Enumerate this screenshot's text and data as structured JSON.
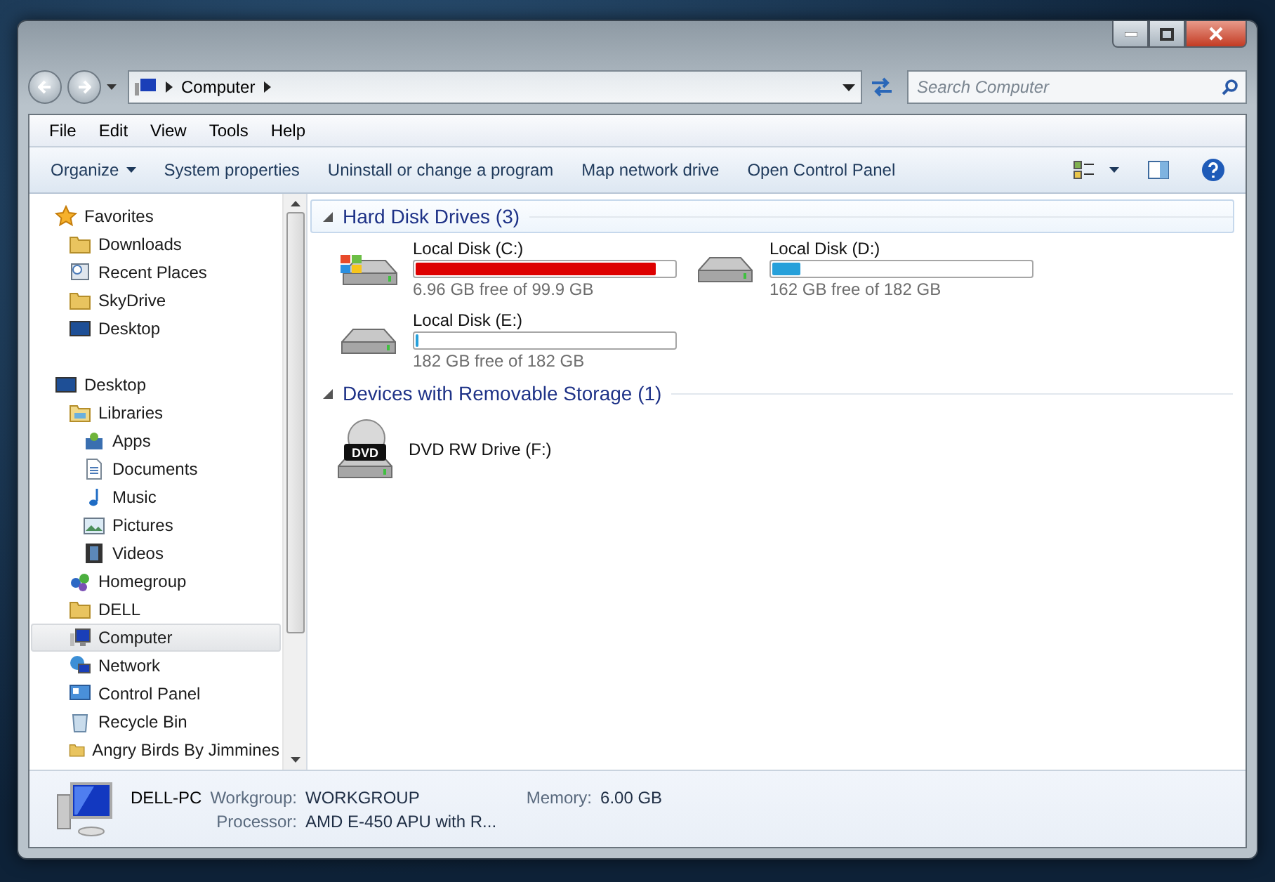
{
  "address_bar": {
    "crumbs": [
      "Computer"
    ]
  },
  "search": {
    "placeholder": "Search Computer"
  },
  "menu_bar": [
    "File",
    "Edit",
    "View",
    "Tools",
    "Help"
  ],
  "command_bar": [
    {
      "label": "Organize",
      "dropdown": true
    },
    {
      "label": "System properties",
      "dropdown": false
    },
    {
      "label": "Uninstall or change a program",
      "dropdown": false
    },
    {
      "label": "Map network drive",
      "dropdown": false
    },
    {
      "label": "Open Control Panel",
      "dropdown": false
    }
  ],
  "navigation": [
    {
      "label": "Favorites",
      "kind": "star",
      "selected": false,
      "children": [
        {
          "label": "Downloads",
          "kind": "folder",
          "selected": false
        },
        {
          "label": "Recent Places",
          "kind": "recent",
          "selected": false
        },
        {
          "label": "SkyDrive",
          "kind": "folder",
          "selected": false
        },
        {
          "label": "Desktop",
          "kind": "monitor",
          "selected": false
        }
      ]
    },
    {
      "label": "Desktop",
      "kind": "monitor",
      "selected": false,
      "children": [
        {
          "label": "Libraries",
          "kind": "library",
          "selected": false,
          "children": [
            {
              "label": "Apps",
              "kind": "apps",
              "selected": false
            },
            {
              "label": "Documents",
              "kind": "document",
              "selected": false
            },
            {
              "label": "Music",
              "kind": "music",
              "selected": false
            },
            {
              "label": "Pictures",
              "kind": "picture",
              "selected": false
            },
            {
              "label": "Videos",
              "kind": "film",
              "selected": false
            }
          ]
        },
        {
          "label": "Homegroup",
          "kind": "homegroup",
          "selected": false
        },
        {
          "label": "DELL",
          "kind": "folder",
          "selected": false
        },
        {
          "label": "Computer",
          "kind": "computer",
          "selected": true
        },
        {
          "label": "Network",
          "kind": "network",
          "selected": false
        },
        {
          "label": "Control Panel",
          "kind": "panel",
          "selected": false
        },
        {
          "label": "Recycle Bin",
          "kind": "bin",
          "selected": false
        },
        {
          "label": "Angry Birds By Jimmines",
          "kind": "folder",
          "selected": false
        }
      ]
    }
  ],
  "groups": [
    {
      "title": "Hard Disk Drives (3)",
      "expanded": true,
      "items": [
        {
          "name": "Local Disk (C:)",
          "kind": "system",
          "level": 0.93,
          "color": "#dd0000",
          "free": "6.96 GB free of 99.9 GB"
        },
        {
          "name": "Local Disk (D:)",
          "kind": "hdd",
          "level": 0.11,
          "color": "#26a0da",
          "free": "162 GB free of 182 GB"
        },
        {
          "name": "Local Disk (E:)",
          "kind": "hdd",
          "level": 0.01,
          "color": "#26a0da",
          "free": "182 GB free of 182 GB"
        }
      ]
    },
    {
      "title": "Devices with Removable Storage (1)",
      "expanded": true,
      "items": [
        {
          "name": "DVD RW Drive (F:)",
          "kind": "dvd",
          "badge": "DVD"
        }
      ]
    }
  ],
  "details": {
    "name": "DELL-PC",
    "fields": [
      {
        "label": "Workgroup:",
        "value": "WORKGROUP"
      },
      {
        "label": "Memory:",
        "value": "6.00 GB"
      },
      {
        "label": "Processor:",
        "value": "AMD E-450 APU with R..."
      }
    ]
  }
}
